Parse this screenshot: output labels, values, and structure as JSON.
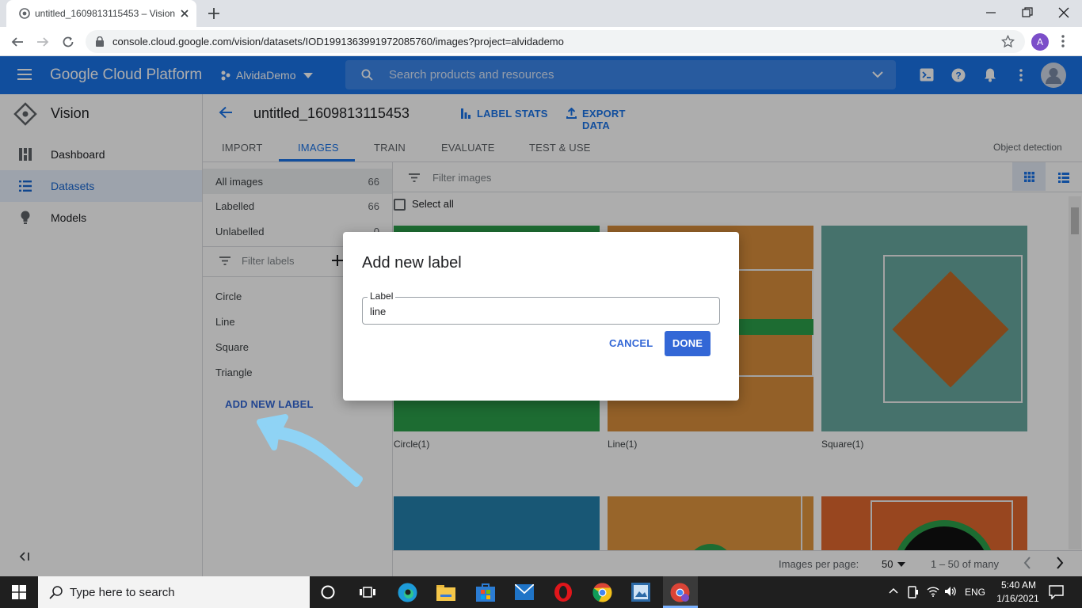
{
  "browser": {
    "tab_title": "untitled_1609813115453 – Vision",
    "url": "console.cloud.google.com/vision/datasets/IOD1991363991972085760/images?project=alvidademo",
    "profile_initial": "A"
  },
  "gcp": {
    "brand": "Google Cloud Platform",
    "project": "AlvidaDemo",
    "search_placeholder": "Search products and resources"
  },
  "sidebar": {
    "title": "Vision",
    "items": [
      {
        "label": "Dashboard",
        "icon": "dashboard-icon"
      },
      {
        "label": "Datasets",
        "icon": "list-icon",
        "active": true
      },
      {
        "label": "Models",
        "icon": "lightbulb-icon"
      }
    ]
  },
  "dataset": {
    "title": "untitled_1609813115453",
    "label_stats": "LABEL STATS",
    "export_data": "EXPORT DATA",
    "tabs": [
      "IMPORT",
      "IMAGES",
      "TRAIN",
      "EVALUATE",
      "TEST & USE"
    ],
    "active_tab": "IMAGES",
    "mode": "Object detection"
  },
  "filters": {
    "all_images": {
      "label": "All images",
      "count": "66"
    },
    "labelled": {
      "label": "Labelled",
      "count": "66"
    },
    "unlabelled": {
      "label": "Unlabelled",
      "count": "0"
    },
    "filter_labels_placeholder": "Filter labels",
    "labels": [
      "Circle",
      "Line",
      "Square",
      "Triangle"
    ],
    "add_new_label": "ADD NEW LABEL"
  },
  "images": {
    "filter_placeholder": "Filter images",
    "select_all": "Select all",
    "captions": [
      "Circle(1)",
      "Line(1)",
      "Square(1)"
    ]
  },
  "pagination": {
    "label": "Images per page:",
    "per_page": "50",
    "range": "1 – 50 of many"
  },
  "dialog": {
    "title": "Add new label",
    "field_label": "Label",
    "field_value": "line",
    "cancel": "CANCEL",
    "done": "DONE"
  },
  "taskbar": {
    "search_placeholder": "Type here to search",
    "language": "ENG",
    "time": "5:40 AM",
    "date": "1/16/2021"
  },
  "colors": {
    "gcp_blue": "#1a73e8",
    "accent": "#3367d6",
    "annotation_arrow": "#8fd3f5"
  }
}
